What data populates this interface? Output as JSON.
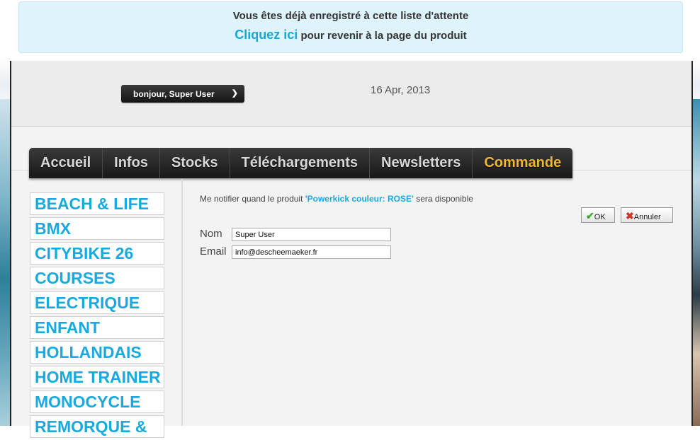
{
  "notice": {
    "line1": "Vous êtes déjà enregistré à cette liste d'attente",
    "link": "Cliquez ici",
    "line2_rest": " pour revenir à la page du produit"
  },
  "header": {
    "user_label": "bonjour, Super User",
    "date": "16 Apr, 2013"
  },
  "nav": {
    "tabs": [
      "Accueil",
      "Infos",
      "Stocks",
      "Téléchargements",
      "Newsletters",
      "Commande"
    ]
  },
  "sidebar": {
    "categories": [
      "BEACH & LIFE",
      "BMX",
      "CITYBIKE 26",
      "COURSES",
      "ELECTRIQUE",
      "ENFANT",
      "HOLLANDAIS",
      "HOME TRAINER",
      "MONOCYCLE",
      "REMORQUE &"
    ]
  },
  "main": {
    "notify_prefix": "Me notifier quand le produit ",
    "product": "'Powerkick couleur: ROSE'",
    "notify_suffix": " sera disponible",
    "ok_label": "OK",
    "cancel_label": "Annuler",
    "name_label": "Nom",
    "name_value": "Super User",
    "email_label": "Email",
    "email_value": "info@descheemaeker.fr"
  },
  "colors": {
    "accent": "#18a9df",
    "active_tab": "#f0b631",
    "notice_bg": "#def3fb"
  }
}
